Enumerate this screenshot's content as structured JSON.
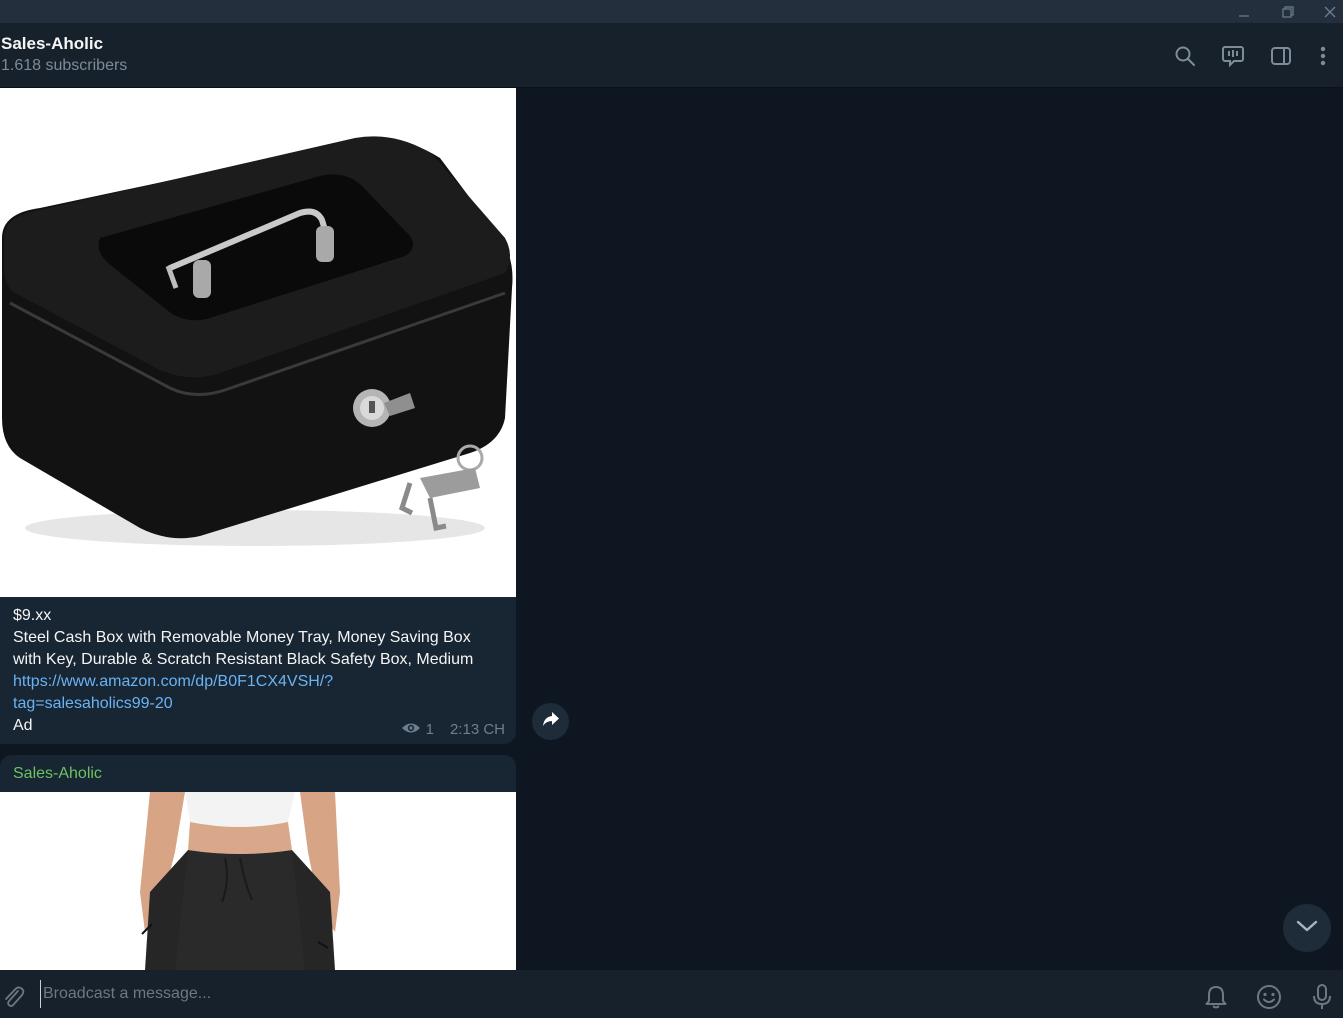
{
  "window": {
    "minimize_icon": "minimize-icon",
    "restore_icon": "restore-icon",
    "close_icon": "close-icon"
  },
  "header": {
    "title": "Sales-Aholic",
    "subtitle": "1.618 subscribers",
    "icons": [
      "search-icon",
      "live-stream-icon",
      "sidebar-toggle-icon",
      "more-vertical-icon"
    ]
  },
  "messages": [
    {
      "price": "$9.xx",
      "description": "Steel Cash Box with Removable Money Tray, Money Saving Box with Key, Durable & Scratch Resistant Black Safety Box, Medium",
      "link_line1": "https://www.amazon.com/dp/B0F1CX4VSH/?",
      "link_line2": "tag=salesaholics99-20",
      "ad_label": "Ad",
      "views": "1",
      "time": "2:13 CH",
      "photo_subject": "black steel cash box with keys"
    },
    {
      "sender": "Sales-Aholic",
      "photo_subject": "woman wearing black jogger pants"
    }
  ],
  "composer": {
    "placeholder": "Broadcast a message..."
  },
  "colors": {
    "background": "#0e1621",
    "panel": "#17212b",
    "bubble": "#182533",
    "link": "#6ab3f3",
    "sender": "#6cc264"
  }
}
